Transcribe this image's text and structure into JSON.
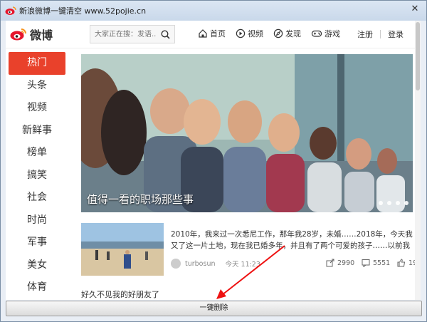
{
  "window": {
    "title": "新浪微博一键清空 www.52pojie.cn",
    "close_glyph": "✕"
  },
  "header": {
    "logo_text": "微博",
    "search_placeholder": "大家正在搜：发语...",
    "nav": [
      {
        "label": "首页",
        "icon": "home-icon"
      },
      {
        "label": "视频",
        "icon": "video-icon"
      },
      {
        "label": "发现",
        "icon": "discover-icon"
      },
      {
        "label": "游戏",
        "icon": "game-icon"
      }
    ],
    "register": "注册",
    "login": "登录"
  },
  "sidebar": {
    "items": [
      {
        "label": "热门",
        "active": true
      },
      {
        "label": "头条"
      },
      {
        "label": "视频"
      },
      {
        "label": "新鲜事"
      },
      {
        "label": "榜单"
      },
      {
        "label": "搞笑"
      },
      {
        "label": "社会"
      },
      {
        "label": "时尚"
      },
      {
        "label": "军事"
      },
      {
        "label": "美女"
      },
      {
        "label": "体育"
      }
    ]
  },
  "banner": {
    "caption": "值得一看的职场那些事",
    "dots": 4
  },
  "article": {
    "text": "2010年，我来过一次悉尼工作，那年我28岁，未婚……2018年，今天我又了这一片土地，现在我已婚多年，并且有了两个可爱的孩子……以前我不曾",
    "author": "turbosun",
    "time": "今天 11:23",
    "shares": "2990",
    "comments": "5551",
    "likes": "19"
  },
  "post2": {
    "text": "好久不见我的好朋友了"
  },
  "footer": {
    "clear_button": "一键删除"
  },
  "colors": {
    "accent": "#e9412b",
    "titlebar": "#c9d8ea"
  }
}
